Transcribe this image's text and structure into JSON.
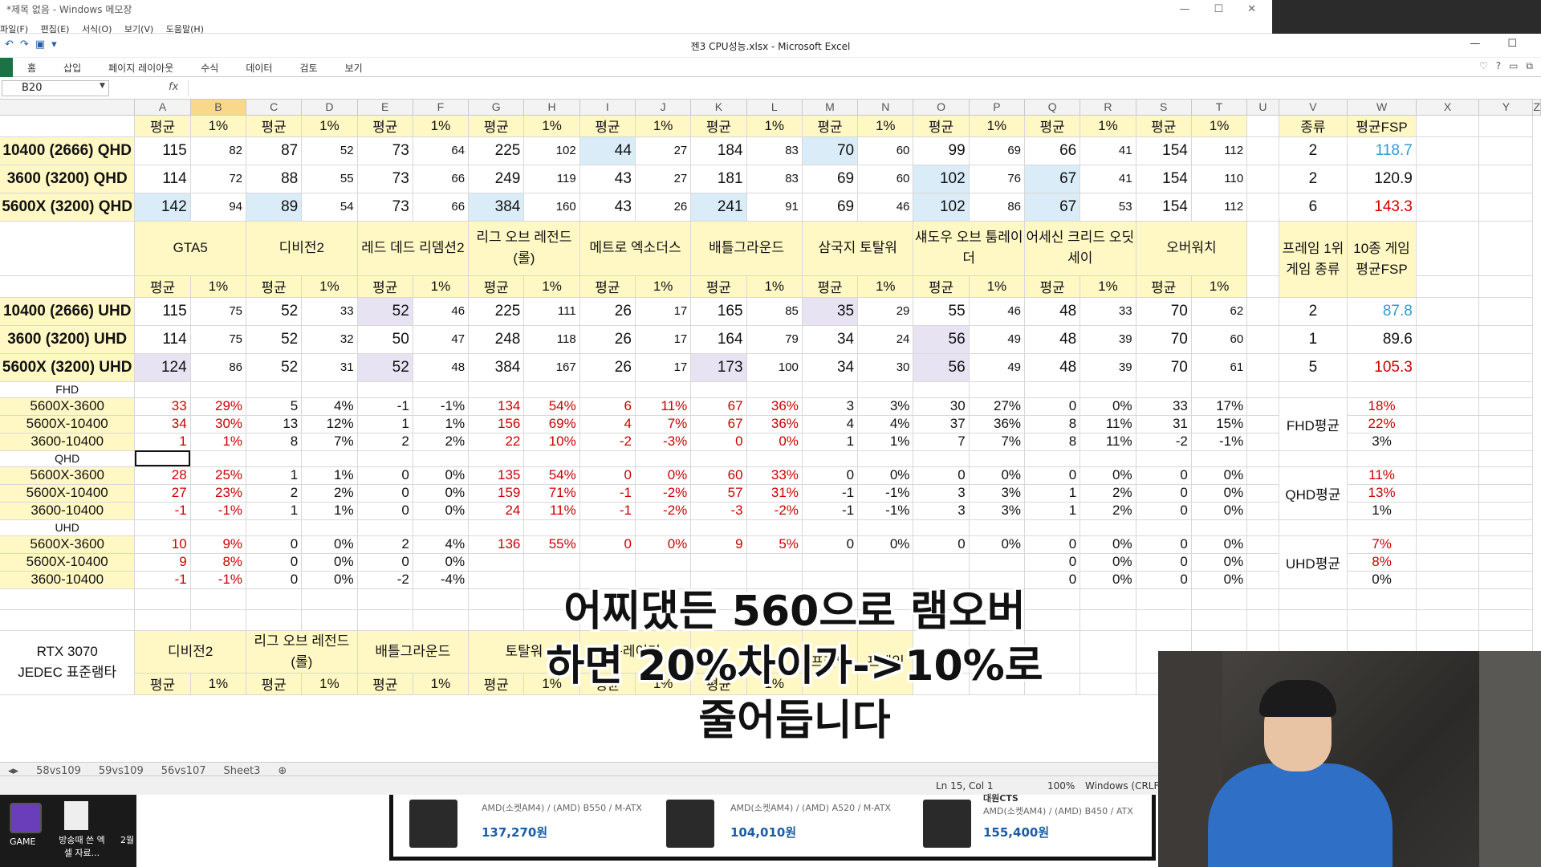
{
  "notepad": {
    "title": "*제목 없음 - Windows 메모장",
    "menu": [
      "파일(F)",
      "편집(E)",
      "서식(O)",
      "보기(V)",
      "도움말(H)"
    ]
  },
  "excel": {
    "filename": "젠3 CPU성능.xlsx - Microsoft Excel",
    "ribbon_tabs": [
      "홈",
      "삽입",
      "페이지 레이아웃",
      "수식",
      "데이터",
      "검토",
      "보기"
    ],
    "namebox": "B20",
    "fx": "fx",
    "columns": [
      "A",
      "B",
      "C",
      "D",
      "E",
      "F",
      "G",
      "H",
      "I",
      "J",
      "K",
      "L",
      "M",
      "N",
      "O",
      "P",
      "Q",
      "R",
      "S",
      "T",
      "U",
      "V",
      "W",
      "X",
      "Y",
      "Z"
    ],
    "sheets": [
      "58vs109",
      "59vs109",
      "56vs107",
      "Sheet3"
    ],
    "status": {
      "position": "Ln 15, Col 1",
      "zoom": "100%",
      "eol": "Windows (CRLF)"
    }
  },
  "labels": {
    "avg": "평균",
    "low": "1%",
    "kind": "종류",
    "avg_fsp": "평균FSP",
    "frame_top": "프레임 1위 게임 종류",
    "ten_games": "10종 게임 평균FSP",
    "fhd": "FHD",
    "qhd": "QHD",
    "uhd": "UHD",
    "fhd_avg": "FHD평균",
    "qhd_avg": "QHD평균",
    "uhd_avg": "UHD평균"
  },
  "games": [
    "GTA5",
    "디비전2",
    "레드 데드 리뎀션2",
    "리그 오브 레전드(롤)",
    "메트로 엑소더스",
    "배틀그라운드",
    "삼국지 토탈워",
    "섀도우 오브 툼레이더",
    "어세신 크리드 오딧세이",
    "오버워치"
  ],
  "qhd_rows": [
    {
      "label": "10400 (2666) QHD",
      "vals": [
        "115",
        "82",
        "87",
        "52",
        "73",
        "64",
        "225",
        "102",
        "44",
        "27",
        "184",
        "83",
        "70",
        "60",
        "99",
        "69",
        "66",
        "41",
        "154",
        "112"
      ],
      "kind": "2",
      "fsp": "118.7"
    },
    {
      "label": "3600 (3200) QHD",
      "vals": [
        "114",
        "72",
        "88",
        "55",
        "73",
        "66",
        "249",
        "119",
        "43",
        "27",
        "181",
        "83",
        "69",
        "60",
        "102",
        "76",
        "67",
        "41",
        "154",
        "110"
      ],
      "kind": "2",
      "fsp": "120.9"
    },
    {
      "label": "5600X (3200) QHD",
      "vals": [
        "142",
        "94",
        "89",
        "54",
        "73",
        "66",
        "384",
        "160",
        "43",
        "26",
        "241",
        "91",
        "69",
        "46",
        "102",
        "86",
        "67",
        "53",
        "154",
        "112"
      ],
      "kind": "6",
      "fsp": "143.3"
    }
  ],
  "uhd_rows": [
    {
      "label": "10400 (2666) UHD",
      "vals": [
        "115",
        "75",
        "52",
        "33",
        "52",
        "46",
        "225",
        "111",
        "26",
        "17",
        "165",
        "85",
        "35",
        "29",
        "55",
        "46",
        "48",
        "33",
        "70",
        "62"
      ],
      "kind": "2",
      "fsp": "87.8"
    },
    {
      "label": "3600 (3200) UHD",
      "vals": [
        "114",
        "75",
        "52",
        "32",
        "50",
        "47",
        "248",
        "118",
        "26",
        "17",
        "164",
        "79",
        "34",
        "24",
        "56",
        "49",
        "48",
        "39",
        "70",
        "60"
      ],
      "kind": "1",
      "fsp": "89.6"
    },
    {
      "label": "5600X (3200) UHD",
      "vals": [
        "124",
        "86",
        "52",
        "31",
        "52",
        "48",
        "384",
        "167",
        "26",
        "17",
        "173",
        "100",
        "34",
        "30",
        "56",
        "49",
        "48",
        "39",
        "70",
        "61"
      ],
      "kind": "5",
      "fsp": "105.3"
    }
  ],
  "fhd_diff": [
    {
      "label": "5600X-3600",
      "vals": [
        "33",
        "29%",
        "5",
        "4%",
        "-1",
        "-1%",
        "134",
        "54%",
        "6",
        "11%",
        "67",
        "36%",
        "3",
        "3%",
        "30",
        "27%",
        "0",
        "0%",
        "33",
        "17%"
      ],
      "avg": "18%"
    },
    {
      "label": "5600X-10400",
      "vals": [
        "34",
        "30%",
        "13",
        "12%",
        "1",
        "1%",
        "156",
        "69%",
        "4",
        "7%",
        "67",
        "36%",
        "4",
        "4%",
        "37",
        "36%",
        "8",
        "11%",
        "31",
        "15%"
      ],
      "avg": "22%"
    },
    {
      "label": "3600-10400",
      "vals": [
        "1",
        "1%",
        "8",
        "7%",
        "2",
        "2%",
        "22",
        "10%",
        "-2",
        "-3%",
        "0",
        "0%",
        "1",
        "1%",
        "7",
        "7%",
        "8",
        "11%",
        "-2",
        "-1%"
      ],
      "avg": "3%"
    }
  ],
  "qhd_diff": [
    {
      "label": "5600X-3600",
      "vals": [
        "28",
        "25%",
        "1",
        "1%",
        "0",
        "0%",
        "135",
        "54%",
        "0",
        "0%",
        "60",
        "33%",
        "0",
        "0%",
        "0",
        "0%",
        "0",
        "0%",
        "0",
        "0%"
      ],
      "avg": "11%"
    },
    {
      "label": "5600X-10400",
      "vals": [
        "27",
        "23%",
        "2",
        "2%",
        "0",
        "0%",
        "159",
        "71%",
        "-1",
        "-2%",
        "57",
        "31%",
        "-1",
        "-1%",
        "3",
        "3%",
        "1",
        "2%",
        "0",
        "0%"
      ],
      "avg": "13%"
    },
    {
      "label": "3600-10400",
      "vals": [
        "-1",
        "-1%",
        "1",
        "1%",
        "0",
        "0%",
        "24",
        "11%",
        "-1",
        "-2%",
        "-3",
        "-2%",
        "-1",
        "-1%",
        "3",
        "3%",
        "1",
        "2%",
        "0",
        "0%"
      ],
      "avg": "1%"
    }
  ],
  "uhd_diff": [
    {
      "label": "5600X-3600",
      "vals": [
        "10",
        "9%",
        "0",
        "0%",
        "2",
        "4%",
        "136",
        "55%",
        "0",
        "0%",
        "9",
        "5%",
        "0",
        "0%",
        "0",
        "0%",
        "0",
        "0%",
        "0",
        "0%"
      ],
      "avg": "7%"
    },
    {
      "label": "5600X-10400",
      "vals": [
        "9",
        "8%",
        "0",
        "0%",
        "0",
        "0%",
        "",
        "",
        "",
        "",
        "",
        "",
        "",
        "",
        "",
        "",
        "0",
        "0%",
        "0",
        "0%"
      ],
      "avg": "8%"
    },
    {
      "label": "3600-10400",
      "vals": [
        "-1",
        "-1%",
        "0",
        "0%",
        "-2",
        "-4%",
        "",
        "",
        "",
        "",
        "",
        "",
        "",
        "",
        "",
        "",
        "0",
        "0%",
        "0",
        "0%"
      ],
      "avg": "0%"
    }
  ],
  "bottom": {
    "label1": "RTX 3070",
    "label2": "JEDEC 표준램타",
    "games": [
      "디비전2",
      "리그 오브 레전드(롤)",
      "배틀그라운드",
      "토탈워",
      "툼레이더",
      "프레임",
      "프레임"
    ]
  },
  "caption": {
    "line1": "어찌댔든 560으로 램오버",
    "line2": "하면 20%차이가->10%로",
    "line3": "줄어듭니다"
  },
  "taskbar": {
    "game": "GAME",
    "doc": "방송때 쓴 엑셀 자료...",
    "two": "2월"
  },
  "ads": [
    {
      "desc": "AMD(소켓AM4) / (AMD) B550 / M-ATX",
      "price": "137,270원"
    },
    {
      "desc": "AMD(소켓AM4) / (AMD) A520 / M-ATX",
      "price": "104,010원"
    },
    {
      "vendor": "대원CTS",
      "desc": "AMD(소켓AM4) / (AMD) B450 / ATX",
      "price": "155,400원"
    }
  ],
  "colors": {
    "header_yellow": "#fff8c4",
    "highlight_blue": "#d9ecf7",
    "highlight_lavender": "#e7e3f2",
    "red_text": "#cc0000",
    "cyan_text": "#2e9bd6"
  }
}
